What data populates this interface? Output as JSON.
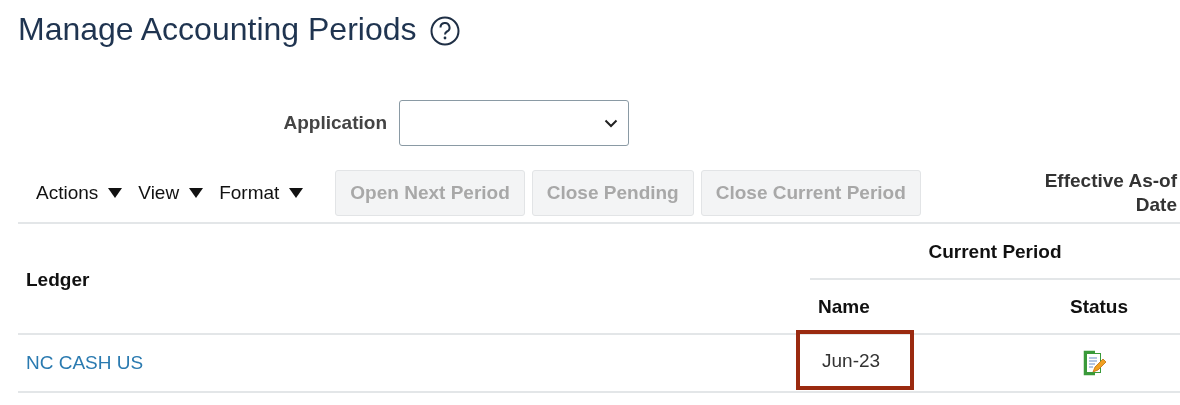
{
  "page": {
    "title": "Manage Accounting Periods",
    "help_icon": true
  },
  "filter": {
    "label": "Application"
  },
  "toolbar": {
    "menus": [
      {
        "label": "Actions"
      },
      {
        "label": "View"
      },
      {
        "label": "Format"
      }
    ],
    "buttons": [
      {
        "label": "Open Next Period",
        "disabled": true
      },
      {
        "label": "Close Pending",
        "disabled": true
      },
      {
        "label": "Close Current Period",
        "disabled": true
      }
    ],
    "effective_label": "Effective As-of Date"
  },
  "table": {
    "columns": {
      "ledger": "Ledger",
      "group": "Current Period",
      "name": "Name",
      "status": "Status"
    },
    "rows": [
      {
        "ledger": "NC CASH US",
        "name": "Jun-23",
        "name_highlighted": true,
        "status_editable": true
      }
    ]
  }
}
